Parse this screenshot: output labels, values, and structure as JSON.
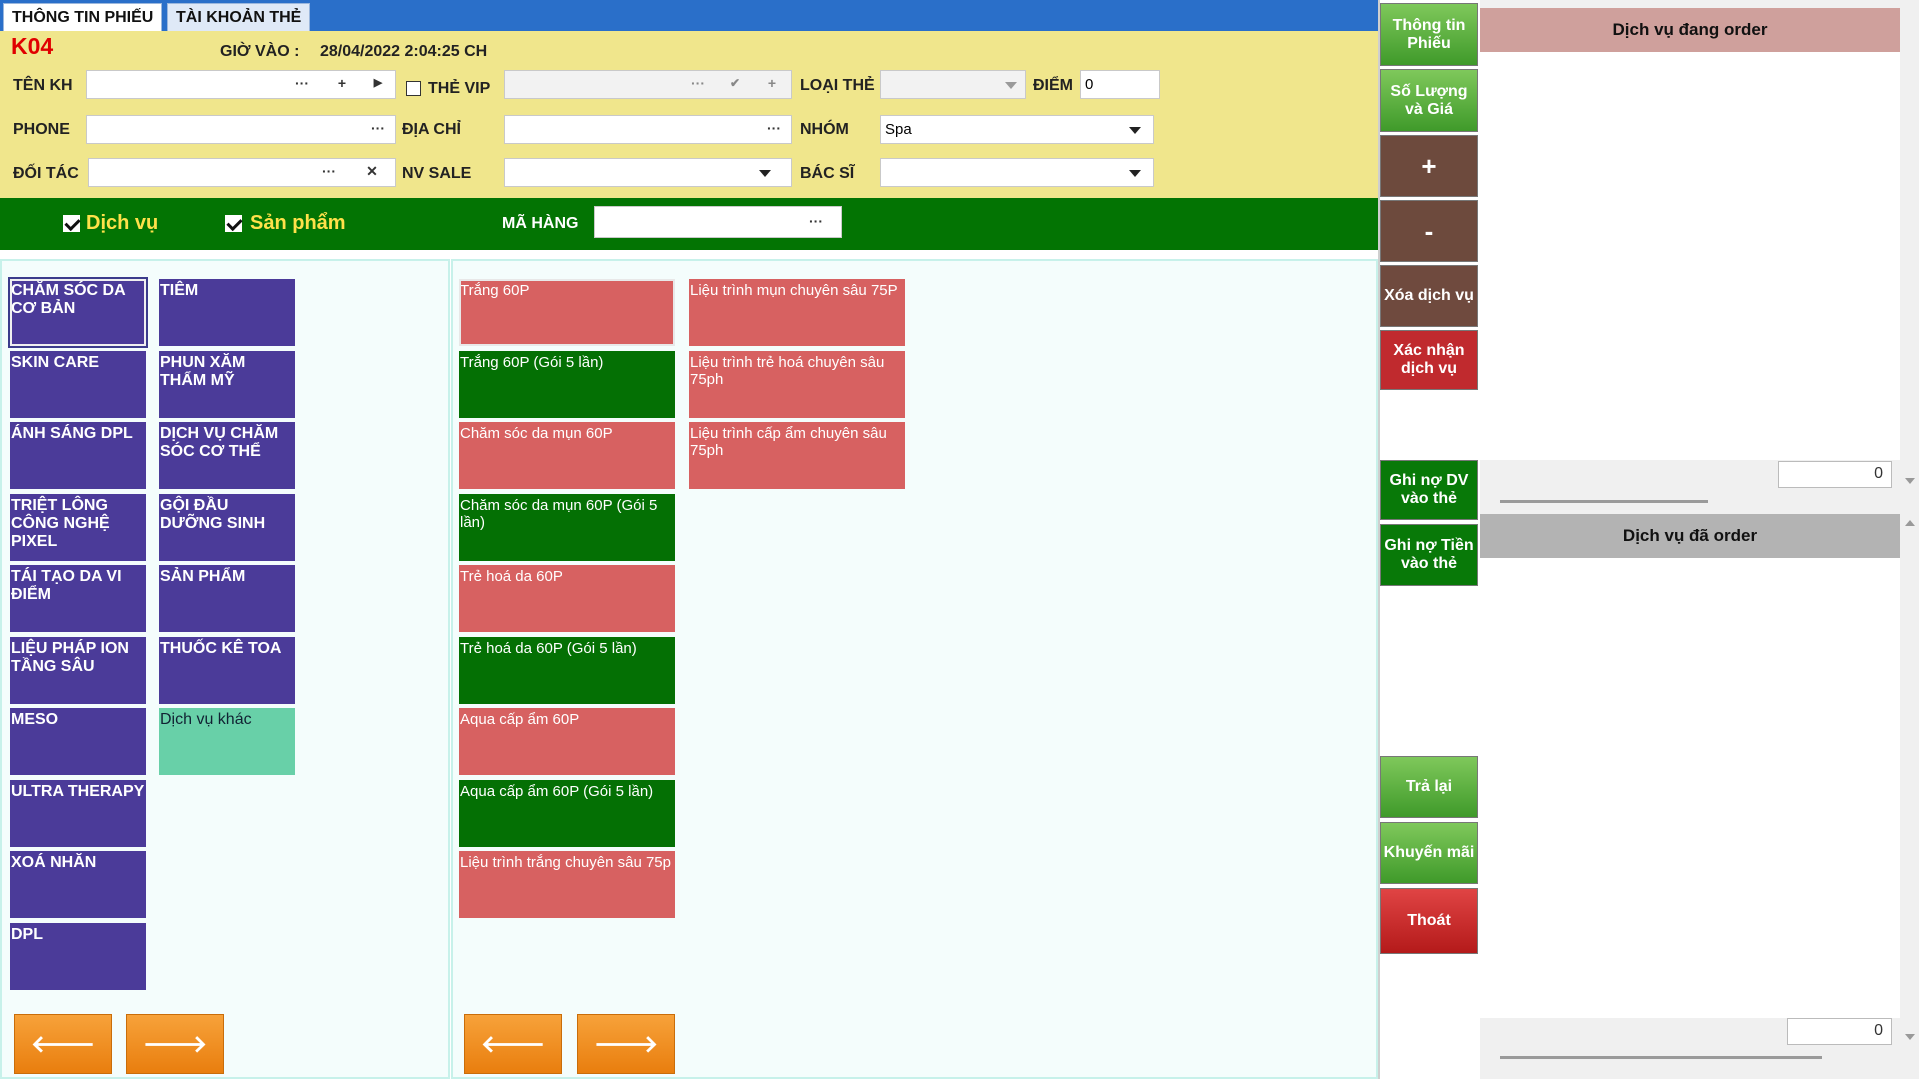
{
  "tabs": [
    "THÔNG TIN PHIẾU",
    "TÀI KHOẢN THẺ"
  ],
  "header": {
    "ticket_code": "K04",
    "time_label": "GIỜ VÀO :",
    "time_value": "28/04/2022 2:04:25 CH"
  },
  "form": {
    "customer_label": "TÊN KH",
    "vip_label": "THẺ VIP",
    "card_type_label": "LOẠI THẺ",
    "points_label": "ĐIỂM",
    "points_value": "0",
    "phone_label": "PHONE",
    "address_label": "ĐỊA CHỈ",
    "group_label": "NHÓM",
    "group_value": "Spa",
    "partner_label": "ĐỐI TÁC",
    "sales_label": "NV SALE",
    "doctor_label": "BÁC SĨ",
    "ellipsis": "···",
    "plus": "+",
    "play": "▶",
    "check": "✔",
    "clear": "✕"
  },
  "filter": {
    "service_label": "Dịch vụ",
    "product_label": "Sản phẩm",
    "item_code_label": "MÃ HÀNG"
  },
  "categories_col1": [
    "CHĂM SÓC DA CƠ BẢN",
    "SKIN CARE",
    "ÁNH SÁNG DPL",
    "TRIỆT LÔNG CÔNG NGHỆ PIXEL",
    "TÁI TẠO DA VI ĐIỂM",
    "LIỆU PHÁP ION TẦNG SÂU",
    "MESO",
    "ULTRA THERAPY",
    "XOÁ NHĂN",
    "DPL"
  ],
  "categories_col2": [
    "TIÊM",
    "PHUN XĂM THẨM MỸ",
    "DỊCH VỤ CHĂM SÓC CƠ THỂ",
    "GỘI ĐẦU DƯỠNG SINH",
    "SẢN PHẨM",
    "THUỐC KÊ TOA",
    "Dịch vụ khác"
  ],
  "services_col1": [
    "Trắng 60P",
    "Trắng 60P (Gói 5 lần)",
    "Chăm sóc da mụn 60P",
    "Chăm sóc da mụn 60P (Gói 5 lần)",
    "Trẻ hoá da 60P",
    "Trẻ hoá da 60P (Gói 5 lần)",
    "Aqua cấp ẩm 60P",
    "Aqua cấp ẩm 60P (Gói 5 lần)",
    "Liệu trình trắng chuyên sâu 75p"
  ],
  "services_col2": [
    "Liệu trình mụn chuyên sâu 75P",
    "Liệu trình trẻ hoá chuyên sâu 75ph",
    "Liệu trình cấp ẩm chuyên sâu 75ph"
  ],
  "nav": {
    "prev": "🡐",
    "next": "🡒"
  },
  "side_buttons": {
    "ticket_info": "Thông tin Phiếu",
    "qty_price": "Số Lượng và Giá",
    "plus": "+",
    "minus": "-",
    "delete_service": "Xóa dịch vụ",
    "confirm_service": "Xác nhận dịch vụ",
    "debt_service_card": "Ghi nợ DV vào thẻ",
    "debt_money_card": "Ghi nợ Tiền vào thẻ",
    "return": "Trả lại",
    "promotion": "Khuyến mãi",
    "exit": "Thoát"
  },
  "right_panel": {
    "ordering_title": "Dịch vụ đang order",
    "ordering_total": "0",
    "ordered_title": "Dịch vụ đã order",
    "ordered_total": "0"
  },
  "colors": {
    "tab_bar": "#2a6fc9",
    "info_bg": "#f0e68c",
    "filter_bg": "#037403",
    "category": "#4b3b99",
    "service_red": "#d76161",
    "service_green": "#047004",
    "nav_orange": "#f08c17"
  }
}
